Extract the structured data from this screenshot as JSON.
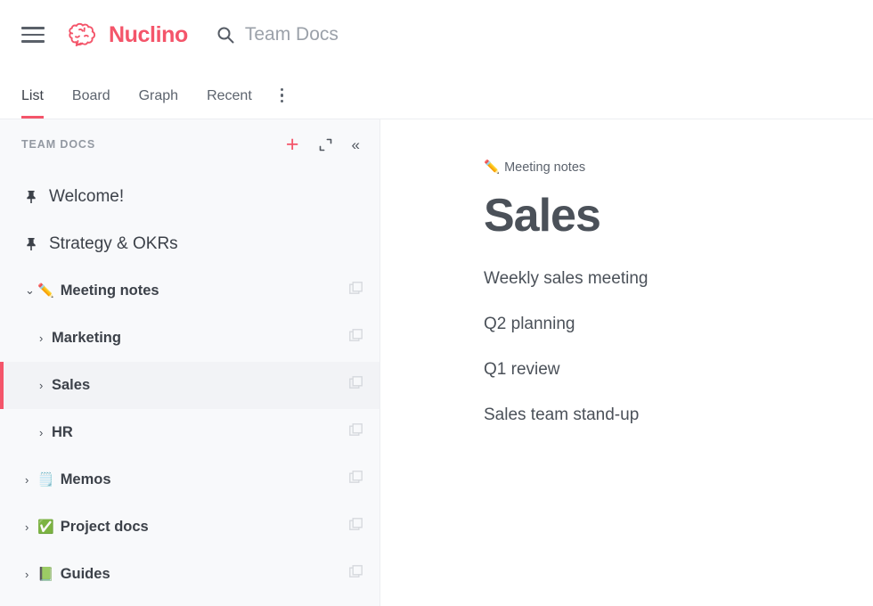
{
  "header": {
    "menu_icon": "hamburger-icon",
    "brand": "Nuclino",
    "brand_icon": "brain-bubble-logo",
    "brand_color": "#f4556a",
    "search_icon": "search-icon",
    "search_placeholder": "Team Docs"
  },
  "tabs": {
    "items": [
      {
        "label": "List",
        "active": true
      },
      {
        "label": "Board",
        "active": false
      },
      {
        "label": "Graph",
        "active": false
      },
      {
        "label": "Recent",
        "active": false
      }
    ],
    "more_icon": "more-vertical-icon",
    "active_underline_color": "#f4556a"
  },
  "sidebar": {
    "title": "TEAM DOCS",
    "actions": [
      {
        "name": "add-item-button",
        "icon": "plus-icon",
        "glyph": "+"
      },
      {
        "name": "expand-sidebar-button",
        "icon": "expand-icon"
      },
      {
        "name": "collapse-sidebar-button",
        "icon": "chevrons-left-icon",
        "glyph": "«"
      }
    ],
    "items": [
      {
        "label": "Welcome!",
        "icon": "pin-icon",
        "emoji": "",
        "caret": "",
        "indent": 0,
        "selected": false,
        "copy": false,
        "style": "plain"
      },
      {
        "label": "Strategy & OKRs",
        "icon": "pin-icon",
        "emoji": "",
        "caret": "",
        "indent": 0,
        "selected": false,
        "copy": false,
        "style": "plain"
      },
      {
        "label": "Meeting notes",
        "icon": "pencil-emoji",
        "emoji": "✏️",
        "caret": "⌄",
        "indent": 0,
        "selected": false,
        "copy": true,
        "style": "bold"
      },
      {
        "label": "Marketing",
        "icon": "",
        "emoji": "",
        "caret": "›",
        "indent": 1,
        "selected": false,
        "copy": true,
        "style": "bold"
      },
      {
        "label": "Sales",
        "icon": "",
        "emoji": "",
        "caret": "›",
        "indent": 1,
        "selected": true,
        "copy": true,
        "style": "bold"
      },
      {
        "label": "HR",
        "icon": "",
        "emoji": "",
        "caret": "›",
        "indent": 1,
        "selected": false,
        "copy": true,
        "style": "bold"
      },
      {
        "label": "Memos",
        "icon": "notepad-emoji",
        "emoji": "🗒️",
        "caret": "›",
        "indent": 0,
        "selected": false,
        "copy": true,
        "style": "bold"
      },
      {
        "label": "Project docs",
        "icon": "checkmark-emoji",
        "emoji": "✅",
        "caret": "›",
        "indent": 0,
        "selected": false,
        "copy": true,
        "style": "bold"
      },
      {
        "label": "Guides",
        "icon": "green-book-emoji",
        "emoji": "📗",
        "caret": "›",
        "indent": 0,
        "selected": false,
        "copy": true,
        "style": "bold"
      }
    ],
    "selected_accent": "#f4556a",
    "selected_background": "#f2f3f6"
  },
  "main": {
    "breadcrumb_emoji": "✏️",
    "breadcrumb": "Meeting notes",
    "title": "Sales",
    "items": [
      "Weekly sales meeting",
      "Q2 planning",
      "Q1 review",
      "Sales team stand-up"
    ]
  }
}
